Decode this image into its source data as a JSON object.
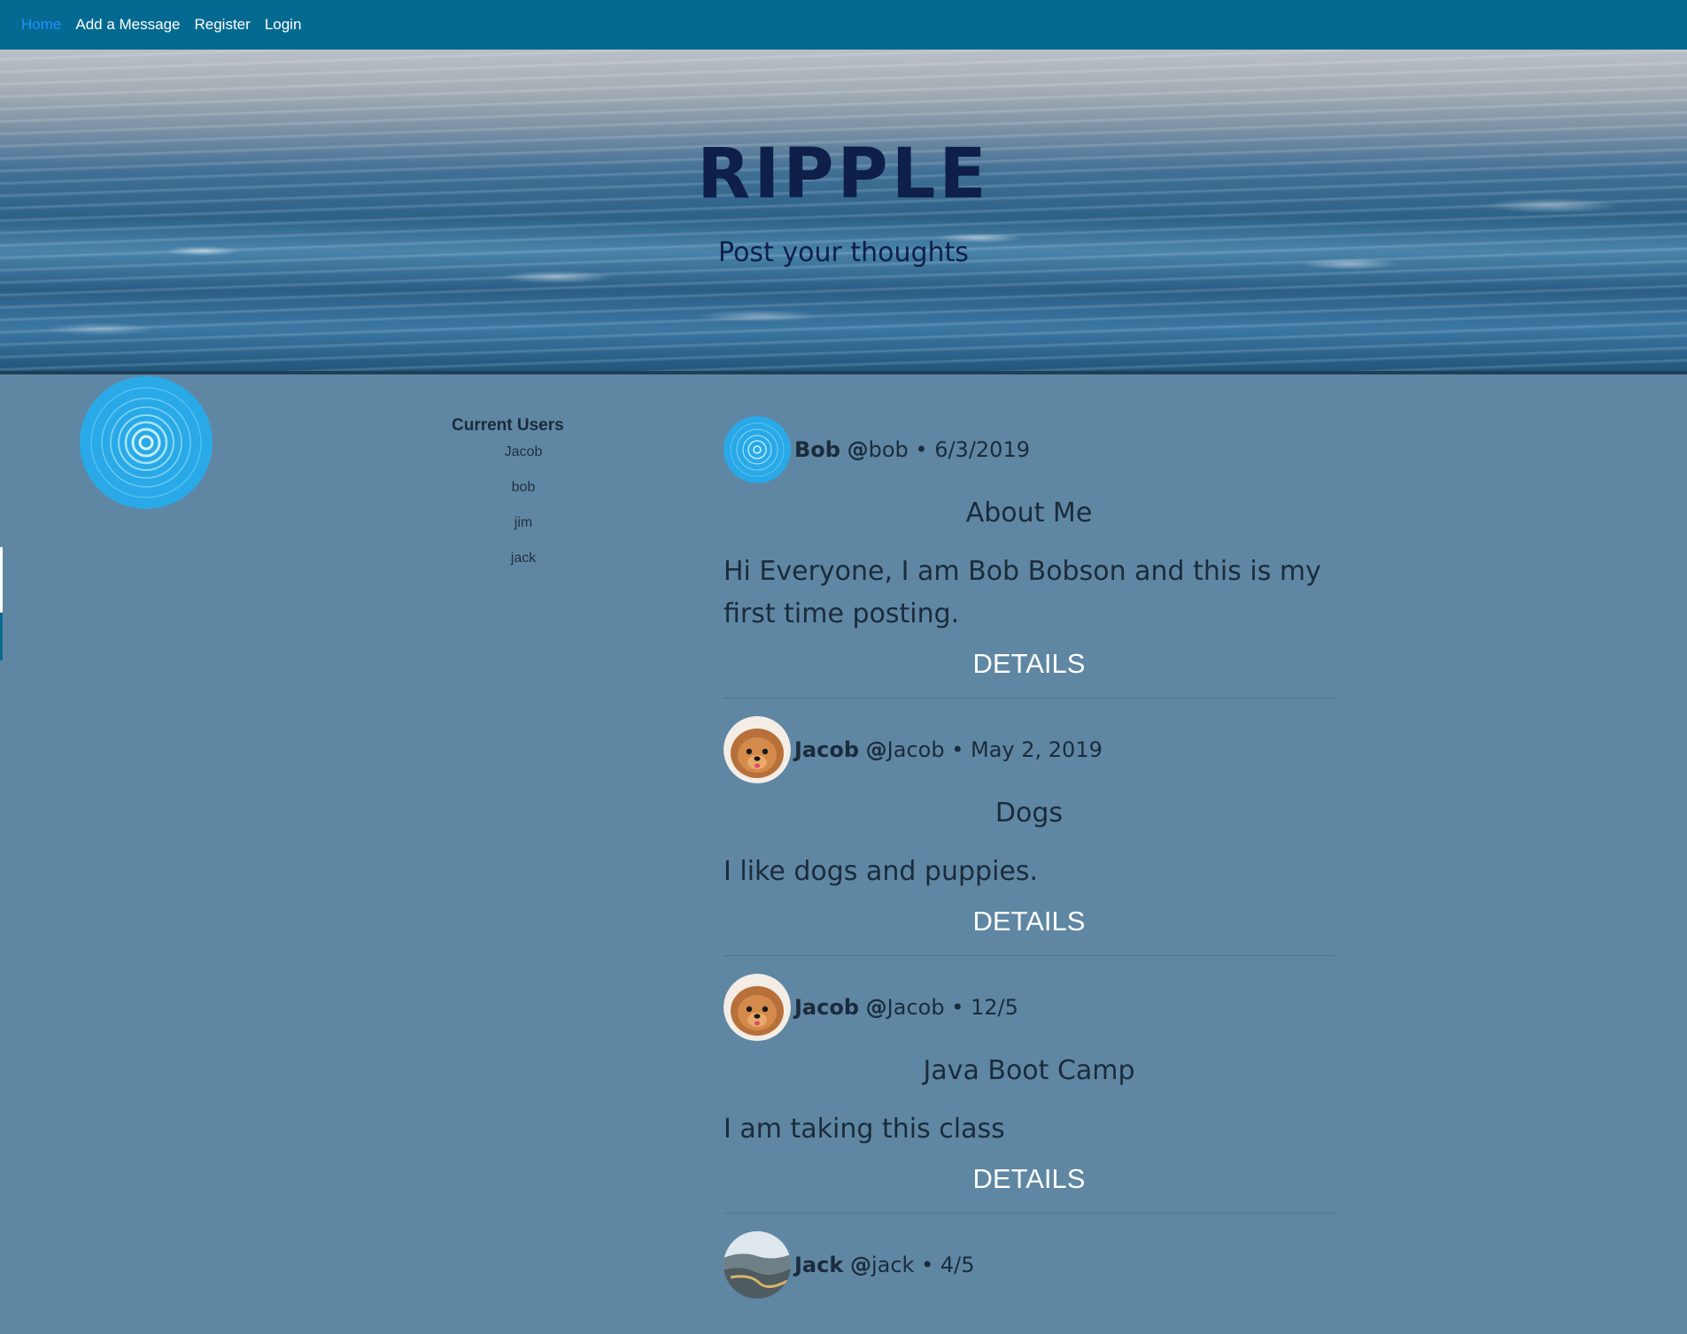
{
  "nav": {
    "items": [
      {
        "label": "Home",
        "active": true
      },
      {
        "label": "Add a Message",
        "active": false
      },
      {
        "label": "Register",
        "active": false
      },
      {
        "label": "Login",
        "active": false
      }
    ]
  },
  "hero": {
    "title": "RIPPLE",
    "subtitle": "Post your thoughts"
  },
  "users": {
    "heading": "Current Users",
    "list": [
      "Jacob",
      "bob",
      "jim",
      "jack"
    ]
  },
  "posts": [
    {
      "avatar": "ripple-avatar-icon",
      "name": "Bob",
      "at": "@",
      "handle": "bob",
      "date": "• 6/3/2019",
      "title": "About Me",
      "body": "Hi Everyone, I am Bob Bobson and this is my first time posting.",
      "details": "DETAILS"
    },
    {
      "avatar": "dog-avatar-icon",
      "name": "Jacob",
      "at": "@",
      "handle": "Jacob",
      "date": "• May 2, 2019",
      "title": "Dogs",
      "body": "I like dogs and puppies.",
      "details": "DETAILS"
    },
    {
      "avatar": "dog-avatar-icon",
      "name": "Jacob",
      "at": "@",
      "handle": "Jacob",
      "date": "• 12/5",
      "title": "Java Boot Camp",
      "body": "I am taking this class",
      "details": "DETAILS"
    },
    {
      "avatar": "landscape-avatar-icon",
      "name": "Jack",
      "at": "@",
      "handle": "jack",
      "date": "• 4/5",
      "title": "",
      "body": "",
      "details": ""
    }
  ],
  "colors": {
    "navbar": "#056a91",
    "page_bg": "#5f87a3",
    "active_link": "#1e90ff",
    "logo": "#29a9e8"
  }
}
